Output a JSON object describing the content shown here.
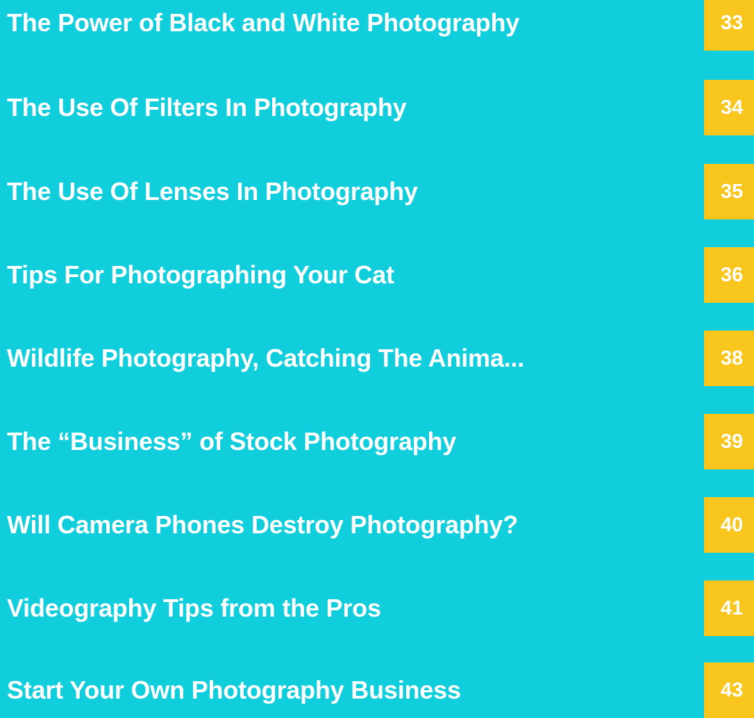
{
  "toc": {
    "entries": [
      {
        "title": "The Power of Black and White Photography",
        "page": "33"
      },
      {
        "title": "The Use Of Filters In Photography",
        "page": "34"
      },
      {
        "title": "The Use Of Lenses In Photography",
        "page": "35"
      },
      {
        "title": "Tips For Photographing Your Cat",
        "page": "36"
      },
      {
        "title": "Wildlife Photography, Catching The Anima...",
        "page": "38"
      },
      {
        "title": "The “Business” of Stock Photography",
        "page": "39"
      },
      {
        "title": "Will Camera Phones Destroy Photography?",
        "page": "40"
      },
      {
        "title": "Videography Tips from the Pros",
        "page": "41"
      },
      {
        "title": "Start Your Own Photography Business",
        "page": "43"
      }
    ]
  },
  "colors": {
    "background": "#11cedc",
    "page_box": "#f8c61c",
    "text": "#ffffff"
  }
}
